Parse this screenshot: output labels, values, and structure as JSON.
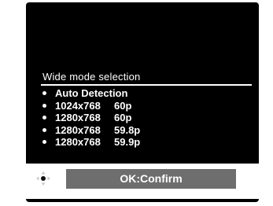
{
  "menu": {
    "title": "Wide mode selection",
    "options": [
      {
        "resolution": "Auto Detection",
        "rate": ""
      },
      {
        "resolution": "1024x768",
        "rate": "60p"
      },
      {
        "resolution": "1280x768",
        "rate": "60p"
      },
      {
        "resolution": "1280x768",
        "rate": "59.8p"
      },
      {
        "resolution": "1280x768",
        "rate": "59.9p"
      }
    ]
  },
  "footer": {
    "nav_icon": "dpad-icon",
    "confirm_label": "OK:Confirm"
  }
}
